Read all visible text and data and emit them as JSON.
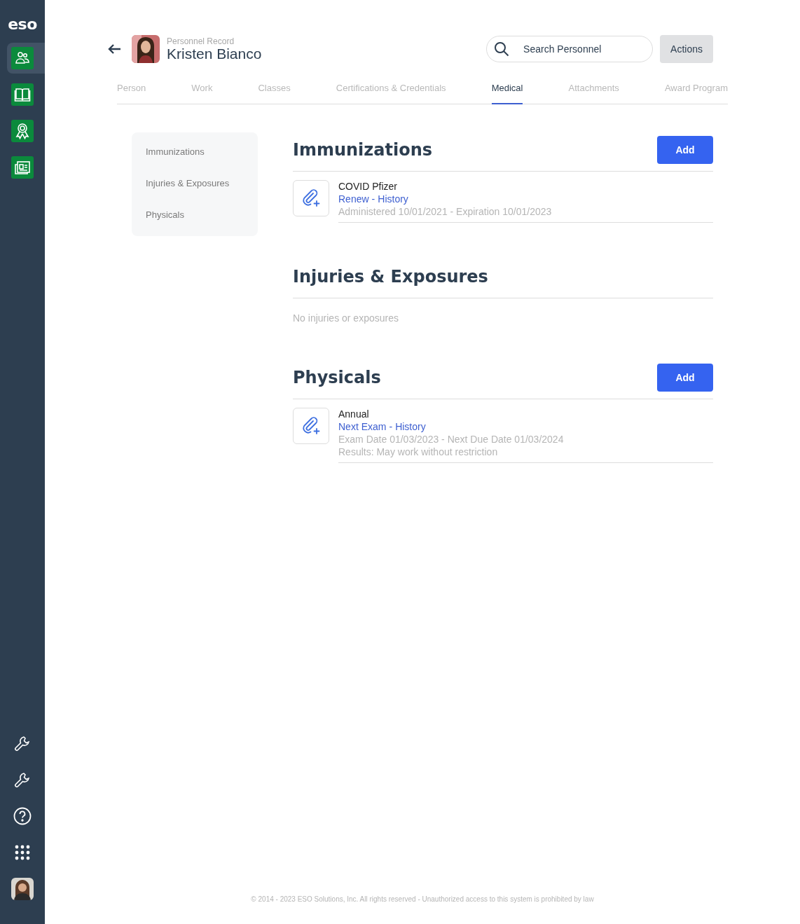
{
  "sidebar": {
    "logo": "eso",
    "top_items": [
      {
        "kind": "people",
        "selected": true
      },
      {
        "kind": "book",
        "selected": false
      },
      {
        "kind": "award",
        "selected": false
      },
      {
        "kind": "news",
        "selected": false
      }
    ],
    "bottom_items": [
      {
        "kind": "wrench"
      },
      {
        "kind": "wrench"
      },
      {
        "kind": "help"
      },
      {
        "kind": "apps"
      },
      {
        "kind": "avatar"
      }
    ]
  },
  "header": {
    "subtitle": "Personnel Record",
    "name": "Kristen Bianco",
    "search": {
      "placeholder": "Search Personnel"
    },
    "actions": "Actions"
  },
  "tabs": [
    {
      "label": "Person",
      "selected": false
    },
    {
      "label": "Work",
      "selected": false
    },
    {
      "label": "Classes",
      "selected": false
    },
    {
      "label": "Certifications & Credentials",
      "selected": false
    },
    {
      "label": "Medical",
      "selected": true
    },
    {
      "label": "Attachments",
      "selected": false
    },
    {
      "label": "Award Program",
      "selected": false
    }
  ],
  "subnav": [
    "Immunizations",
    "Injuries & Exposures",
    "Physicals"
  ],
  "sections": [
    {
      "title": "Immunizations",
      "add_button": "Add",
      "records": [
        {
          "name": "COVID Pfizer",
          "links": [
            "Renew",
            "History"
          ],
          "separator": "-",
          "details": [
            "Administered 10/01/2021 - Expiration 10/01/2023"
          ]
        }
      ]
    },
    {
      "title": "Injuries & Exposures",
      "empty_text": "No injuries or exposures"
    },
    {
      "title": "Physicals",
      "add_button": "Add",
      "records": [
        {
          "name": "Annual",
          "links": [
            "Next Exam",
            "History"
          ],
          "separator": "-",
          "details": [
            "Exam Date 01/03/2023 - Next Due Date 01/03/2024",
            "Results: May work without restriction"
          ]
        }
      ]
    }
  ],
  "footer": "© 2014 - 2023 ESO Solutions, Inc. All rights reserved - Unauthorized access to this system is prohibited by law"
}
